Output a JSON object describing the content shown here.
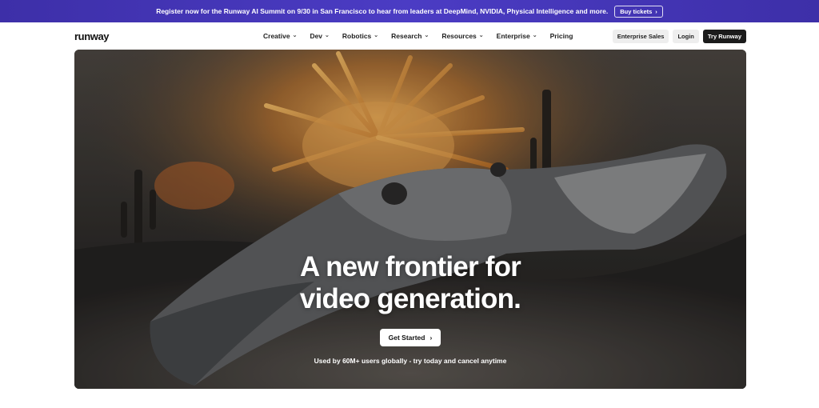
{
  "announcement": {
    "text": "Register now for the Runway AI Summit on 9/30 in San Francisco to hear from leaders at DeepMind, NVIDIA, Physical Intelligence and more.",
    "button_label": "Buy tickets",
    "button_icon": "chevron-right-icon",
    "color": "#4338ca"
  },
  "nav": {
    "logo": "runway",
    "items": [
      {
        "label": "Creative",
        "has_dropdown": true
      },
      {
        "label": "Dev",
        "has_dropdown": true
      },
      {
        "label": "Robotics",
        "has_dropdown": true
      },
      {
        "label": "Research",
        "has_dropdown": true
      },
      {
        "label": "Resources",
        "has_dropdown": true
      },
      {
        "label": "Enterprise",
        "has_dropdown": true
      },
      {
        "label": "Pricing",
        "has_dropdown": false
      }
    ],
    "enterprise_sales": "Enterprise Sales",
    "login": "Login",
    "try_runway": "Try Runway"
  },
  "hero": {
    "title_line1": "A new frontier for",
    "title_line2": "video generation.",
    "cta_label": "Get Started",
    "cta_icon": "chevron-right-icon",
    "note": "Used by 60M+ users globally - try today and cancel anytime"
  }
}
